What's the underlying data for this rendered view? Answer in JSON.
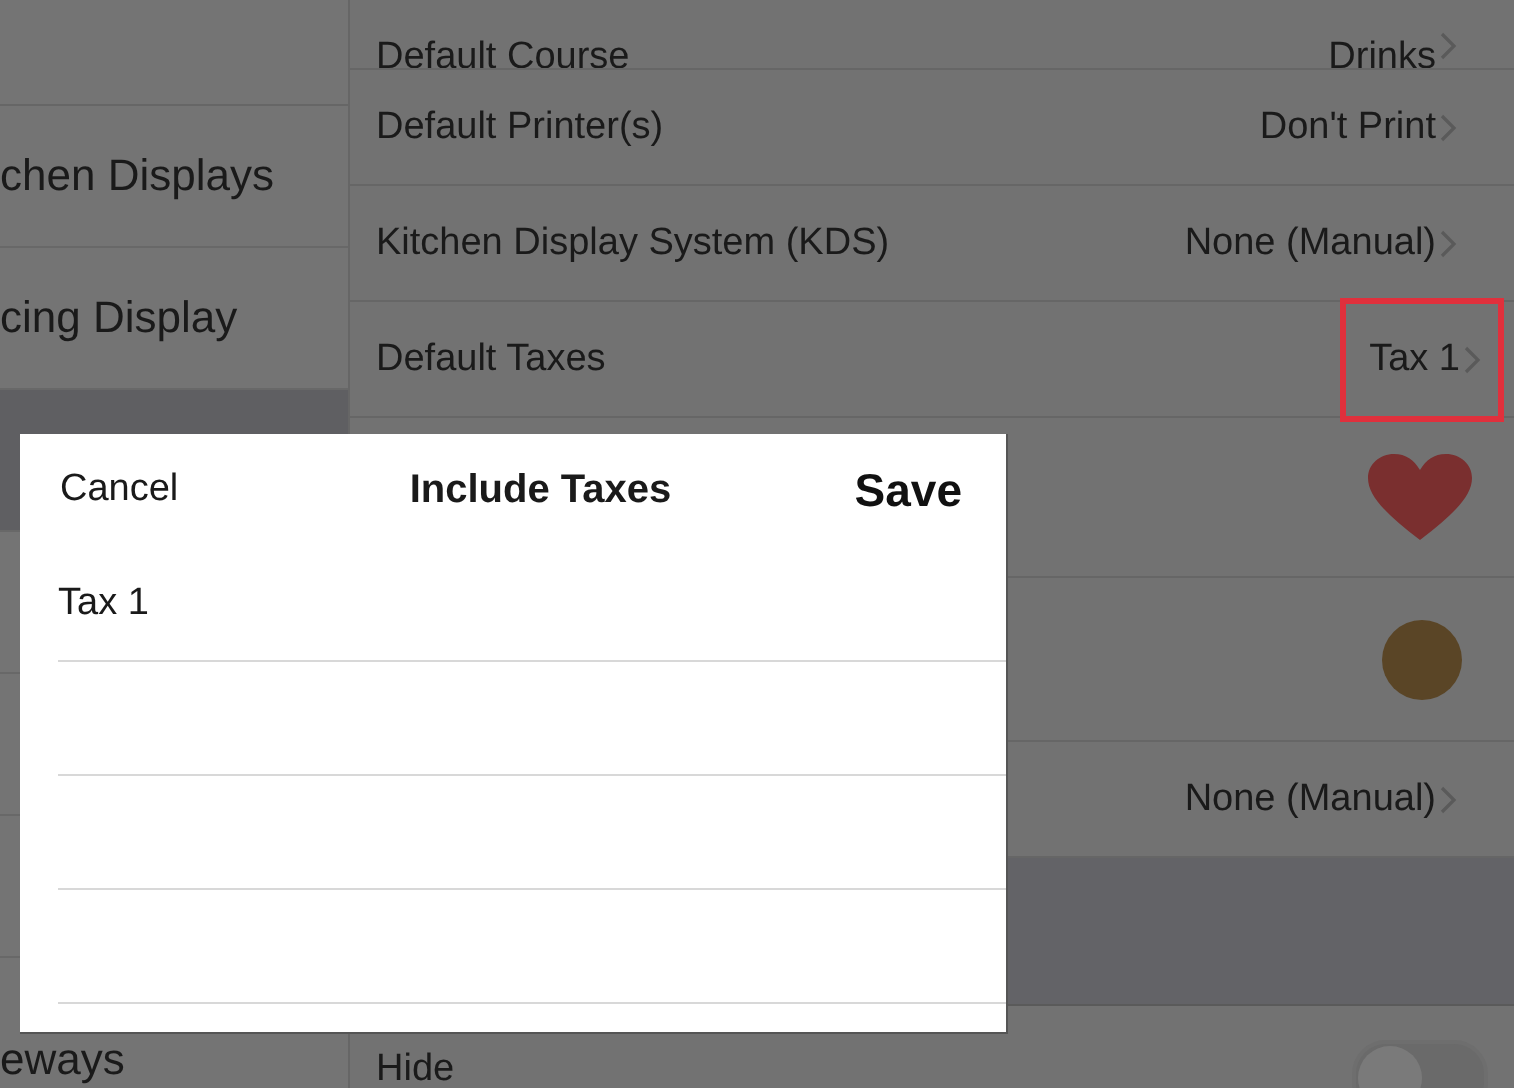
{
  "sidebar": {
    "items": [
      {
        "label": "chen Displays",
        "selected": false
      },
      {
        "label": "cing Display",
        "selected": false
      },
      {
        "selected": true
      },
      {
        "selected": false
      },
      {
        "selected": false
      },
      {
        "selected": false
      },
      {
        "label": "eways",
        "selected": false
      }
    ]
  },
  "settings": {
    "rows": [
      {
        "kind": "value",
        "label": "Default Course",
        "value": "Drinks",
        "highlighted": false
      },
      {
        "kind": "value",
        "label": "Default Printer(s)",
        "value": "Don't Print",
        "highlighted": false
      },
      {
        "kind": "value",
        "label": "Kitchen Display System (KDS)",
        "value": "None (Manual)",
        "highlighted": false
      },
      {
        "kind": "value",
        "label": "Default Taxes",
        "value": "Tax 1",
        "highlighted": true
      },
      {
        "kind": "heart",
        "color": "#7a2f2f"
      },
      {
        "kind": "swatch",
        "color": "#5a4526"
      },
      {
        "kind": "value",
        "value": "None (Manual)",
        "highlighted": false
      },
      {
        "kind": "section"
      },
      {
        "kind": "toggle",
        "label": "Hide",
        "on": false
      }
    ]
  },
  "dialog": {
    "cancel": "Cancel",
    "title": "Include Taxes",
    "save": "Save",
    "rows": [
      {
        "label": "Tax 1"
      }
    ]
  }
}
